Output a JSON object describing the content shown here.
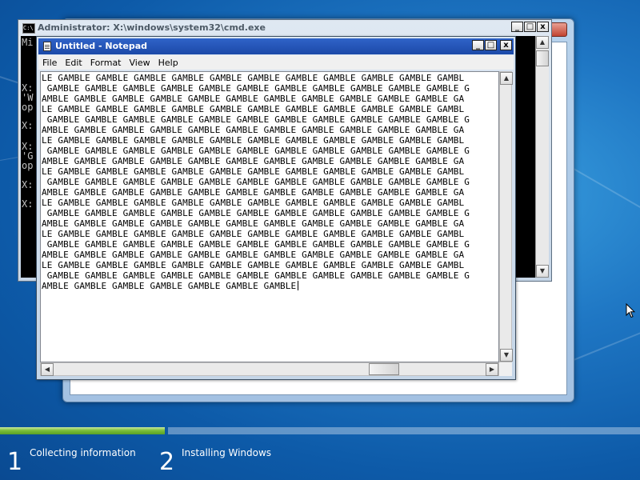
{
  "cmd_window": {
    "title": "Administrator: X:\\windows\\system32\\cmd.exe",
    "icon_label": "C:\\",
    "console_lines": [
      "Mi",
      "",
      "",
      "X:",
      "'W",
      "op",
      "",
      "X:",
      "",
      "X:",
      "'G",
      "op",
      "",
      "X:",
      "",
      "X:"
    ],
    "minimize_label": "_",
    "maximize_label": "□",
    "close_label": "x"
  },
  "notepad": {
    "title": "Untitled - Notepad",
    "menu": [
      "File",
      "Edit",
      "Format",
      "View",
      "Help"
    ],
    "lines": [
      "LE GAMBLE GAMBLE GAMBLE GAMBLE GAMBLE GAMBLE GAMBLE GAMBLE GAMBLE GAMBLE GAMBL",
      " GAMBLE GAMBLE GAMBLE GAMBLE GAMBLE GAMBLE GAMBLE GAMBLE GAMBLE GAMBLE GAMBLE G",
      "AMBLE GAMBLE GAMBLE GAMBLE GAMBLE GAMBLE GAMBLE GAMBLE GAMBLE GAMBLE GAMBLE GA",
      "LE GAMBLE GAMBLE GAMBLE GAMBLE GAMBLE GAMBLE GAMBLE GAMBLE GAMBLE GAMBLE GAMBL",
      " GAMBLE GAMBLE GAMBLE GAMBLE GAMBLE GAMBLE GAMBLE GAMBLE GAMBLE GAMBLE GAMBLE G",
      "AMBLE GAMBLE GAMBLE GAMBLE GAMBLE GAMBLE GAMBLE GAMBLE GAMBLE GAMBLE GAMBLE GA",
      "LE GAMBLE GAMBLE GAMBLE GAMBLE GAMBLE GAMBLE GAMBLE GAMBLE GAMBLE GAMBLE GAMBL",
      " GAMBLE GAMBLE GAMBLE GAMBLE GAMBLE GAMBLE GAMBLE GAMBLE GAMBLE GAMBLE GAMBLE G",
      "AMBLE GAMBLE GAMBLE GAMBLE GAMBLE GAMBLE GAMBLE GAMBLE GAMBLE GAMBLE GAMBLE GA",
      "LE GAMBLE GAMBLE GAMBLE GAMBLE GAMBLE GAMBLE GAMBLE GAMBLE GAMBLE GAMBLE GAMBL",
      " GAMBLE GAMBLE GAMBLE GAMBLE GAMBLE GAMBLE GAMBLE GAMBLE GAMBLE GAMBLE GAMBLE G",
      "AMBLE GAMBLE GAMBLE GAMBLE GAMBLE GAMBLE GAMBLE GAMBLE GAMBLE GAMBLE GAMBLE GA",
      "LE GAMBLE GAMBLE GAMBLE GAMBLE GAMBLE GAMBLE GAMBLE GAMBLE GAMBLE GAMBLE GAMBL",
      " GAMBLE GAMBLE GAMBLE GAMBLE GAMBLE GAMBLE GAMBLE GAMBLE GAMBLE GAMBLE GAMBLE G",
      "AMBLE GAMBLE GAMBLE GAMBLE GAMBLE GAMBLE GAMBLE GAMBLE GAMBLE GAMBLE GAMBLE GA",
      "LE GAMBLE GAMBLE GAMBLE GAMBLE GAMBLE GAMBLE GAMBLE GAMBLE GAMBLE GAMBLE GAMBL",
      " GAMBLE GAMBLE GAMBLE GAMBLE GAMBLE GAMBLE GAMBLE GAMBLE GAMBLE GAMBLE GAMBLE G",
      "AMBLE GAMBLE GAMBLE GAMBLE GAMBLE GAMBLE GAMBLE GAMBLE GAMBLE GAMBLE GAMBLE GA",
      "LE GAMBLE GAMBLE GAMBLE GAMBLE GAMBLE GAMBLE GAMBLE GAMBLE GAMBLE GAMBLE GAMBL",
      " GAMBLE GAMBLE GAMBLE GAMBLE GAMBLE GAMBLE GAMBLE GAMBLE GAMBLE GAMBLE GAMBLE G",
      "AMBLE GAMBLE GAMBLE GAMBLE GAMBLE GAMBLE GAMBLE"
    ],
    "minimize_label": "_",
    "maximize_label": "□",
    "close_label": "x"
  },
  "setup": {
    "steps": [
      {
        "number": "1",
        "label": "Collecting information",
        "progress": 1.0
      },
      {
        "number": "2",
        "label": "Installing Windows",
        "progress": 0.0
      }
    ],
    "progress_color": "#7bbf3a"
  }
}
